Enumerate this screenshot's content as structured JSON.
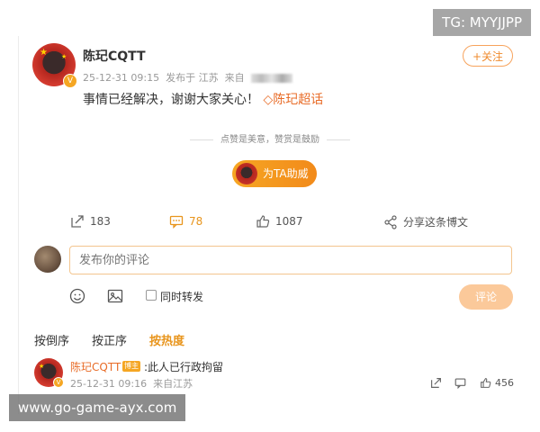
{
  "watermark": {
    "tg": "TG: MYYJJPP",
    "url": "www.go-game-ayx.com"
  },
  "post": {
    "author": "陈玘CQTT",
    "time": "25-12-31 09:15",
    "location": "发布于 江苏",
    "source_prefix": "来自",
    "follow_label": "+关注",
    "text": "事情已经解决，谢谢大家关心！",
    "topic_icon": "diamond-icon",
    "topic": "陈玘超话",
    "divider": "点赞是美意，赞赏是鼓励",
    "cheer_label": "为TA助威"
  },
  "stats": {
    "repost": "183",
    "comment": "78",
    "like": "1087",
    "share": "分享这条博文"
  },
  "composer": {
    "placeholder": "发布你的评论",
    "repost_label": "同时转发",
    "submit_label": "评论"
  },
  "sort": {
    "by_time_desc": "按倒序",
    "by_time_asc": "按正序",
    "by_hot": "按热度"
  },
  "comment": {
    "author": "陈玘CQTT",
    "badge": "博主",
    "text": ":此人已行政拘留",
    "time": "25-12-31 09:16",
    "location": "来自江苏",
    "likes": "456"
  },
  "colors": {
    "accent": "#e8951d",
    "topic": "#e86c28"
  }
}
